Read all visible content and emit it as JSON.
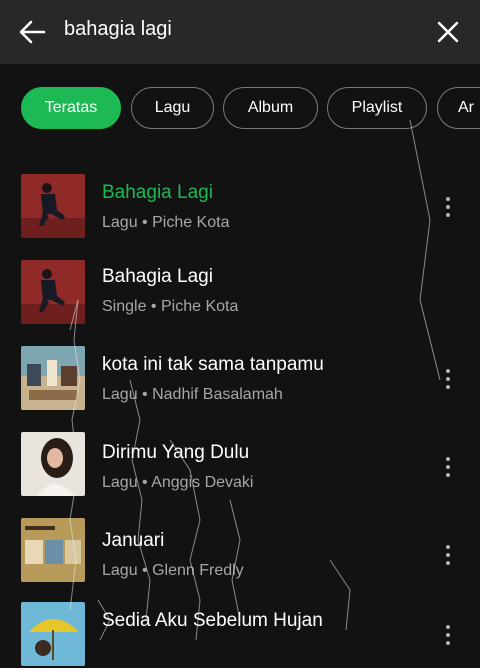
{
  "header": {
    "query": "bahagia lagi",
    "back_icon": "arrow-left-icon",
    "clear_icon": "close-icon"
  },
  "filters": [
    {
      "label": "Teratas",
      "active": true
    },
    {
      "label": "Lagu",
      "active": false
    },
    {
      "label": "Album",
      "active": false
    },
    {
      "label": "Playlist",
      "active": false
    },
    {
      "label": "Ar",
      "active": false
    }
  ],
  "results": [
    {
      "title": "Bahagia Lagi",
      "subtitle": "Lagu • Piche Kota",
      "playing": true
    },
    {
      "title": "Bahagia Lagi",
      "subtitle": "Single • Piche Kota",
      "playing": false
    },
    {
      "title": "kota ini tak sama tanpamu",
      "subtitle": "Lagu • Nadhif Basalamah",
      "playing": false
    },
    {
      "title": "Dirimu Yang Dulu",
      "subtitle": "Lagu • Anggis Devaki",
      "playing": false
    },
    {
      "title": "Januari",
      "subtitle": "Lagu • Glenn Fredly",
      "playing": false
    },
    {
      "title": "Sedia Aku Sebelum Hujan",
      "subtitle": "",
      "playing": false
    }
  ],
  "colors": {
    "accent": "#1db954",
    "background": "#121212",
    "header": "#282828",
    "subtext": "#a7a7a7"
  }
}
